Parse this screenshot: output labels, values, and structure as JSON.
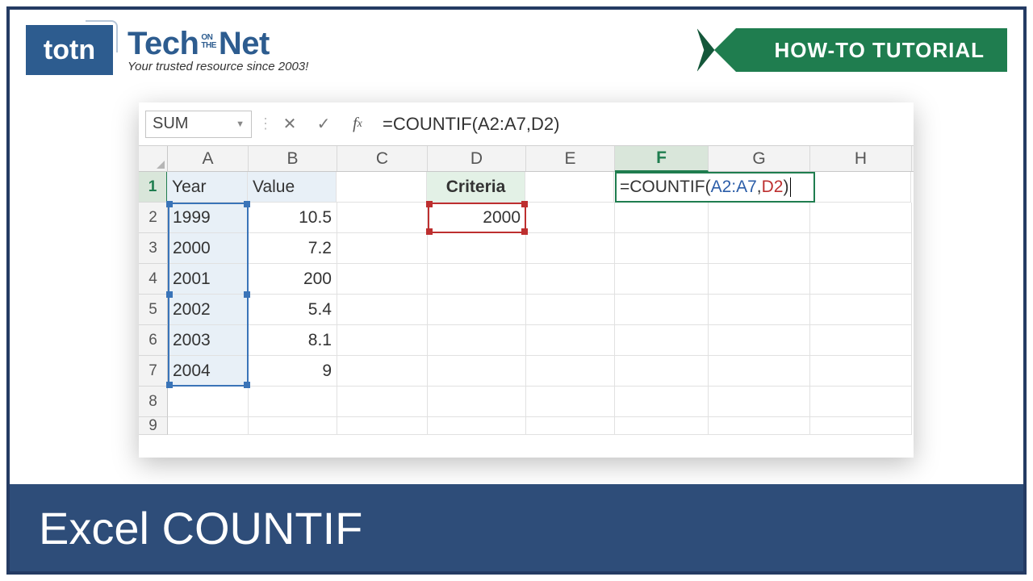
{
  "brand": {
    "logo_text": "totn",
    "name_part1": "Tech",
    "name_on": "ON",
    "name_the": "THE",
    "name_part2": "Net",
    "tagline": "Your trusted resource since 2003!"
  },
  "ribbon_label": "HOW-TO TUTORIAL",
  "footer_title": "Excel COUNTIF",
  "namebox_value": "SUM",
  "formula_bar_value": "=COUNTIF(A2:A7,D2)",
  "active_formula": {
    "prefix": "=COUNTIF(",
    "range": "A2:A7",
    "comma": ",",
    "ref": "D2",
    "suffix": ")"
  },
  "columns": [
    "A",
    "B",
    "C",
    "D",
    "E",
    "F",
    "G",
    "H"
  ],
  "row_headers": [
    "1",
    "2",
    "3",
    "4",
    "5",
    "6",
    "7",
    "8",
    "9"
  ],
  "cells": {
    "A1": "Year",
    "B1": "Value",
    "D1": "Criteria",
    "A2": "1999",
    "B2": "10.5",
    "D2": "2000",
    "A3": "2000",
    "B3": "7.2",
    "A4": "2001",
    "B4": "200",
    "A5": "2002",
    "B5": "5.4",
    "A6": "2003",
    "B6": "8.1",
    "A7": "2004",
    "B7": "9"
  }
}
